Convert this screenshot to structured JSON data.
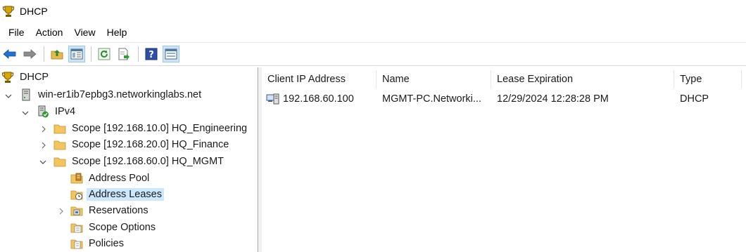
{
  "window": {
    "title": "DHCP",
    "icon": "dhcp-trophy-icon"
  },
  "menu": [
    "File",
    "Action",
    "View",
    "Help"
  ],
  "toolbar": {
    "buttons": [
      "back-arrow-icon",
      "forward-arrow-icon",
      "up-folder-icon",
      "show-hide-tree-icon",
      "refresh-icon",
      "export-list-icon",
      "help-icon",
      "properties-icon"
    ]
  },
  "tree": {
    "root": "DHCP",
    "server": "win-er1ib7epbg3.networkinglabs.net",
    "ipv4": "IPv4",
    "scopes": [
      "Scope [192.168.10.0] HQ_Engineering",
      "Scope [192.168.20.0] HQ_Finance",
      "Scope [192.168.60.0] HQ_MGMT"
    ],
    "scope_children": [
      "Address Pool",
      "Address Leases",
      "Reservations",
      "Scope Options",
      "Policies"
    ],
    "selected": "Address Leases"
  },
  "list": {
    "columns": [
      "Client IP Address",
      "Name",
      "Lease Expiration",
      "Type"
    ],
    "rows": [
      {
        "ip": "192.168.60.100",
        "name": "MGMT-PC.Networki...",
        "expiration": "12/29/2024 12:28:28 PM",
        "type": "DHCP"
      }
    ]
  },
  "colors": {
    "selection": "#cce8ff",
    "folder": "#f2c65c",
    "accent": "#0a64c8"
  }
}
